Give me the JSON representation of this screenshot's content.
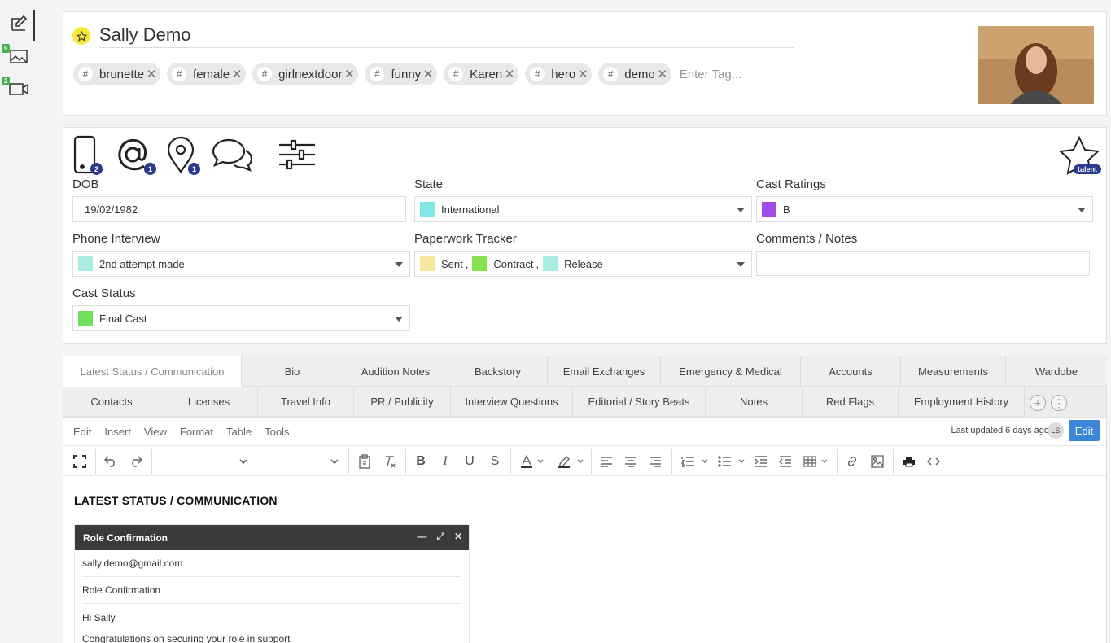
{
  "rail": {
    "images_count": "9",
    "videos_count": "2"
  },
  "profile": {
    "name": "Sally Demo",
    "tags": [
      "brunette",
      "female",
      "girlnextdoor",
      "funny",
      "Karen",
      "hero",
      "demo"
    ],
    "tag_placeholder": "Enter Tag...",
    "tag_hash": "#",
    "tag_remove": "✕"
  },
  "contact_icons": {
    "phone_count": "2",
    "email_count": "1",
    "location_count": "1",
    "talent_label": "talent"
  },
  "fields": {
    "dob_label": "DOB",
    "dob_value": "19/02/1982",
    "state_label": "State",
    "state_value": "International",
    "state_color": "#7fe8e4",
    "cast_ratings_label": "Cast Ratings",
    "cast_ratings_value": "B",
    "cast_ratings_color": "#a24de8",
    "phone_interview_label": "Phone Interview",
    "phone_interview_value": "2nd attempt made",
    "phone_interview_color": "#a8ece5",
    "paperwork_label": "Paperwork Tracker",
    "paperwork_items": [
      {
        "label": "Sent",
        "color": "#f5e6a0",
        "sep": ","
      },
      {
        "label": "Contract",
        "color": "#86e24a",
        "sep": ","
      },
      {
        "label": "Release",
        "color": "#a8ece5",
        "sep": ""
      }
    ],
    "comments_label": "Comments / Notes",
    "comments_value": "",
    "cast_status_label": "Cast Status",
    "cast_status_value": "Final Cast",
    "cast_status_color": "#6fe05a"
  },
  "tabs_row1": [
    "Latest Status / Communication",
    "Bio",
    "Audition Notes",
    "Backstory",
    "Email Exchanges",
    "Emergency & Medical",
    "Accounts",
    "Measurements",
    "Wardobe"
  ],
  "tabs_row2": [
    "Contacts",
    "Licenses",
    "Travel Info",
    "PR / Publicity",
    "Interview Questions",
    "Editorial / Story Beats",
    "Notes",
    "Red Flags",
    "Employment History"
  ],
  "tab_controls": {
    "add": "+",
    "more": "⋮"
  },
  "editor": {
    "menu": [
      "Edit",
      "Insert",
      "View",
      "Format",
      "Table",
      "Tools"
    ],
    "last_updated": "Last updated 6 days ago",
    "user_initials": "LS",
    "edit_label": "Edit",
    "accent_color": "#3b86d9",
    "heading": "LATEST STATUS / COMMUNICATION",
    "email": {
      "title": "Role Confirmation",
      "to": "sally.demo@gmail.com",
      "subject": "Role Confirmation",
      "greeting": "Hi Sally,",
      "body": "Congratulations on securing your role in support"
    }
  }
}
